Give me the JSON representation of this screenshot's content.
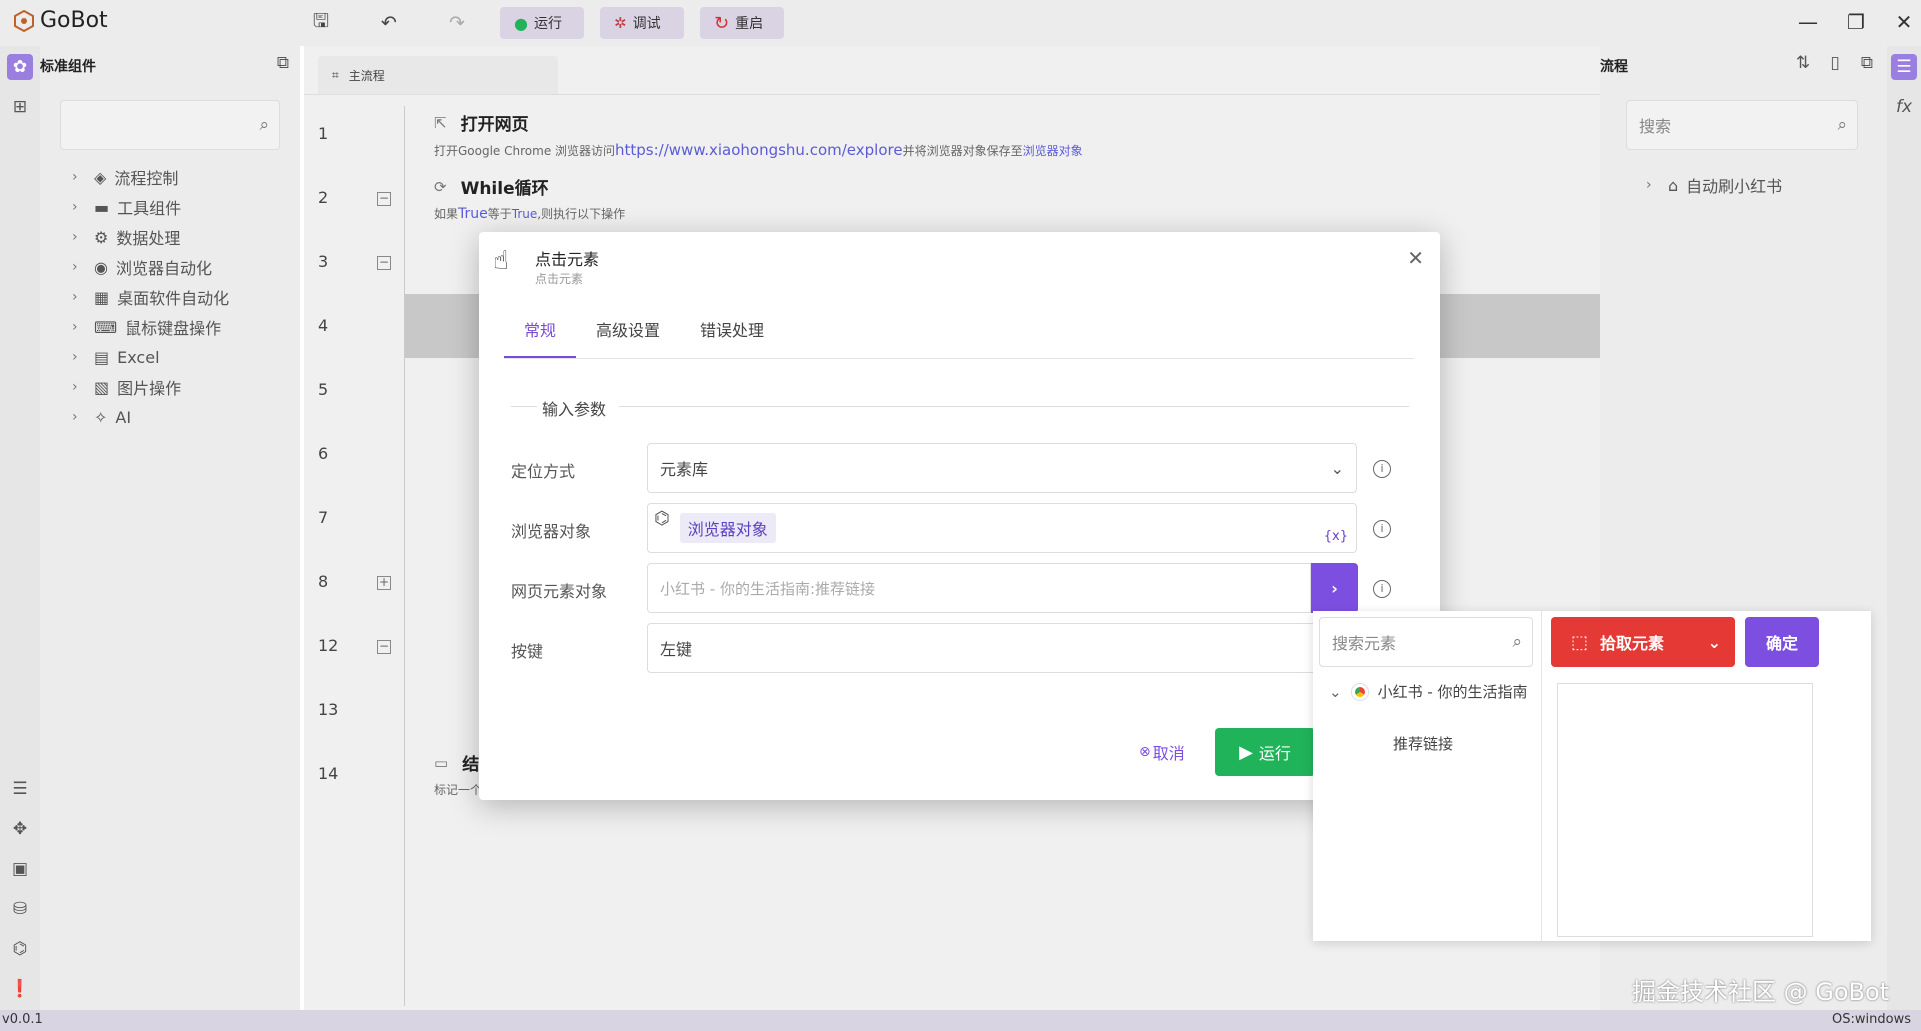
{
  "app": {
    "title": "GoBot",
    "version": "v0.0.1",
    "os": "OS:windows",
    "watermark": "掘金技术社区 @ GoBot"
  },
  "toolbar": {
    "run": "运行",
    "debug": "调试",
    "restart": "重启"
  },
  "left_panel": {
    "title": "标准组件",
    "items": [
      {
        "label": "流程控制"
      },
      {
        "label": "工具组件"
      },
      {
        "label": "数据处理"
      },
      {
        "label": "浏览器自动化"
      },
      {
        "label": "桌面软件自动化"
      },
      {
        "label": "鼠标键盘操作"
      },
      {
        "label": "Excel"
      },
      {
        "label": "图片操作"
      },
      {
        "label": "AI"
      }
    ]
  },
  "editor": {
    "tab": "主流程",
    "line_numbers": [
      "1",
      "2",
      "3",
      "4",
      "5",
      "6",
      "7",
      "8",
      "12",
      "13",
      "14"
    ],
    "step1": {
      "title": "打开网页",
      "desc_prefix": "打开Google Chrome 浏览器访问",
      "url": "https://www.xiaohongshu.com/explore",
      "desc_mid": "并将浏览器对象保存至",
      "desc_var": "浏览器对象"
    },
    "step2": {
      "title": "While循环",
      "desc_prefix": "如果",
      "cond_a": "True",
      "desc_mid": "等于",
      "cond_b": "True",
      "desc_suffix": ",则执行以下操作"
    },
    "step_end": {
      "title_char": "结",
      "desc": "标记一个"
    }
  },
  "right_panel": {
    "title": "流程",
    "search_placeholder": "搜索",
    "tree_item": "自动刷小红书"
  },
  "dialog": {
    "title": "点击元素",
    "subtitle": "点击元素",
    "tabs": [
      "常规",
      "高级设置",
      "错误处理"
    ],
    "section": "输入参数",
    "fields": {
      "locate_label": "定位方式",
      "locate_value": "元素库",
      "browser_label": "浏览器对象",
      "browser_value": "浏览器对象",
      "browser_var_icon": "{x}",
      "element_label": "网页元素对象",
      "element_placeholder": "小红书 - 你的生活指南:推荐链接",
      "key_label": "按键",
      "key_value": "左键"
    },
    "cancel": "取消",
    "run": "运行"
  },
  "popup": {
    "search_placeholder": "搜索元素",
    "pick": "拾取元素",
    "confirm": "确定",
    "tree_root": "小红书 - 你的生活指南",
    "tree_child": "推荐链接"
  },
  "colors": {
    "accent": "#7d4fe0",
    "red": "#e53935",
    "green": "#21b35a"
  }
}
